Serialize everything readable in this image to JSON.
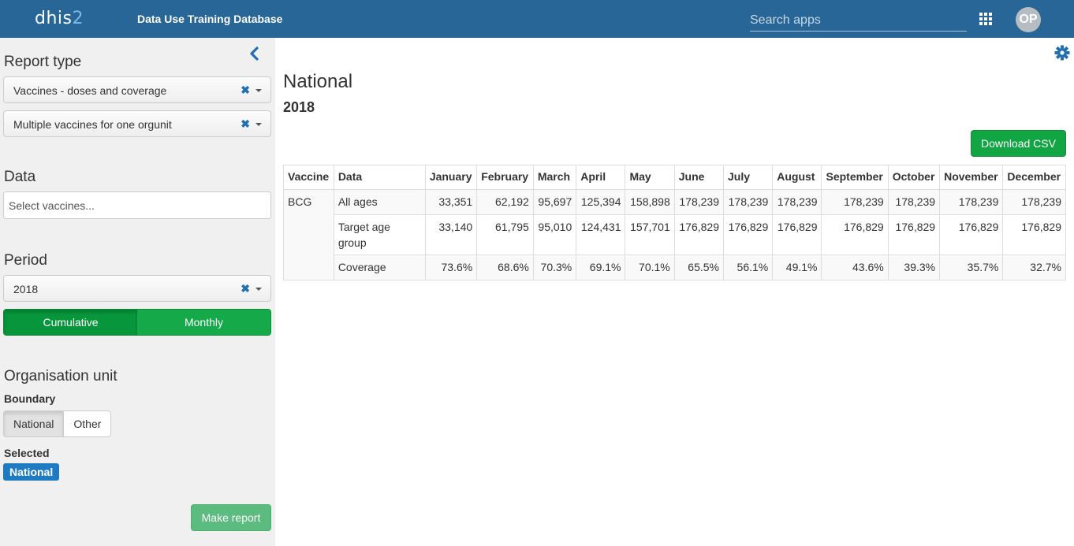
{
  "header": {
    "logo_text": "dhis",
    "logo_number": "2",
    "app_title": "Data Use Training Database",
    "search_placeholder": "Search apps",
    "avatar_initials": "OP"
  },
  "sidebar": {
    "report_type_title": "Report type",
    "report_type_value": "Vaccines - doses and coverage",
    "report_subtype_value": "Multiple vaccines for one orgunit",
    "data_title": "Data",
    "vaccines_placeholder": "Select vaccines...",
    "period_title": "Period",
    "period_value": "2018",
    "cumulative_label": "Cumulative",
    "monthly_label": "Monthly",
    "orgunit_title": "Organisation unit",
    "boundary_label": "Boundary",
    "boundary_national": "National",
    "boundary_other": "Other",
    "selected_label": "Selected",
    "selected_badge": "National",
    "make_report_label": "Make report",
    "clear_glyph": "✖"
  },
  "main": {
    "title": "National",
    "subtitle": "2018",
    "download_label": "Download CSV"
  },
  "table": {
    "headers": [
      "Vaccine",
      "Data",
      "January",
      "February",
      "March",
      "April",
      "May",
      "June",
      "July",
      "August",
      "September",
      "October",
      "November",
      "December"
    ],
    "vaccine": "BCG",
    "rows": [
      {
        "label": "All ages",
        "values": [
          "33,351",
          "62,192",
          "95,697",
          "125,394",
          "158,898",
          "178,239",
          "178,239",
          "178,239",
          "178,239",
          "178,239",
          "178,239",
          "178,239"
        ]
      },
      {
        "label": "Target age group",
        "values": [
          "33,140",
          "61,795",
          "95,010",
          "124,431",
          "157,701",
          "176,829",
          "176,829",
          "176,829",
          "176,829",
          "176,829",
          "176,829",
          "176,829"
        ]
      },
      {
        "label": "Coverage",
        "values": [
          "73.6%",
          "68.6%",
          "70.3%",
          "69.1%",
          "70.1%",
          "65.5%",
          "56.1%",
          "49.1%",
          "43.6%",
          "39.3%",
          "35.7%",
          "32.7%"
        ]
      }
    ]
  },
  "colors": {
    "header_bg": "#276696",
    "sidebar_bg": "#f0f0f0",
    "primary_green": "#12a543",
    "badge_blue": "#1f7bc1"
  }
}
